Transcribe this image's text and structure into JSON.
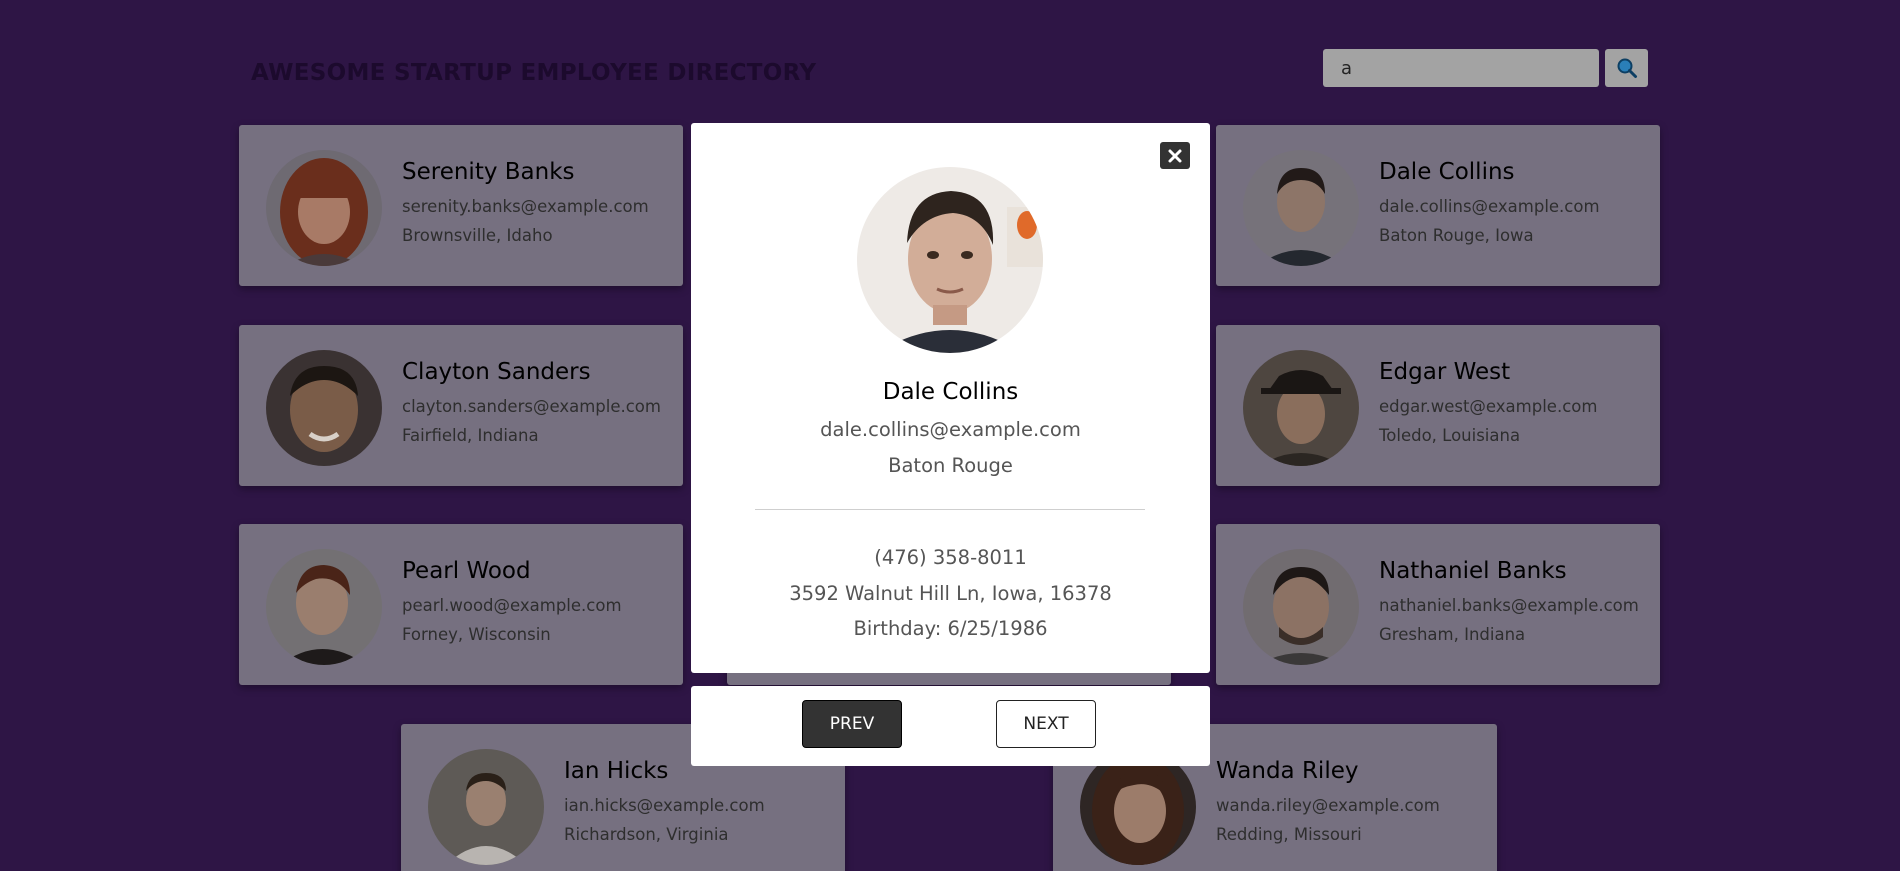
{
  "header": {
    "title": "AWESOME STARTUP EMPLOYEE DIRECTORY",
    "search_value": "a",
    "search_icon": "search-icon"
  },
  "employees": [
    {
      "name": "Serenity Banks",
      "email": "serenity.banks@example.com",
      "location": "Brownsville, Idaho"
    },
    {
      "name": "Dale Collins",
      "email": "dale.collins@example.com",
      "location": "Baton Rouge, Iowa"
    },
    {
      "name": "Clayton Sanders",
      "email": "clayton.sanders@example.com",
      "location": "Fairfield, Indiana"
    },
    {
      "name": "Edgar West",
      "email": "edgar.west@example.com",
      "location": "Toledo, Louisiana"
    },
    {
      "name": "Pearl Wood",
      "email": "pearl.wood@example.com",
      "location": "Forney, Wisconsin"
    },
    {
      "name": "Nathaniel Banks",
      "email": "nathaniel.banks@example.com",
      "location": "Gresham, Indiana"
    },
    {
      "name": "Ian Hicks",
      "email": "ian.hicks@example.com",
      "location": "Richardson, Virginia"
    },
    {
      "name": "Wanda Riley",
      "email": "wanda.riley@example.com",
      "location": "Redding, Missouri"
    }
  ],
  "modal": {
    "name": "Dale Collins",
    "email": "dale.collins@example.com",
    "city": "Baton Rouge",
    "phone": "(476) 358-8011",
    "address": "3592 Walnut Hill Ln, Iowa, 16378",
    "birthday": "Birthday: 6/25/1986",
    "close_icon": "close-icon",
    "prev_label": "PREV",
    "next_label": "NEXT"
  },
  "colors": {
    "overlay_background": "#2e1545",
    "card_background": "#767080",
    "modal_background": "#ffffff",
    "prev_button": "#333333"
  }
}
